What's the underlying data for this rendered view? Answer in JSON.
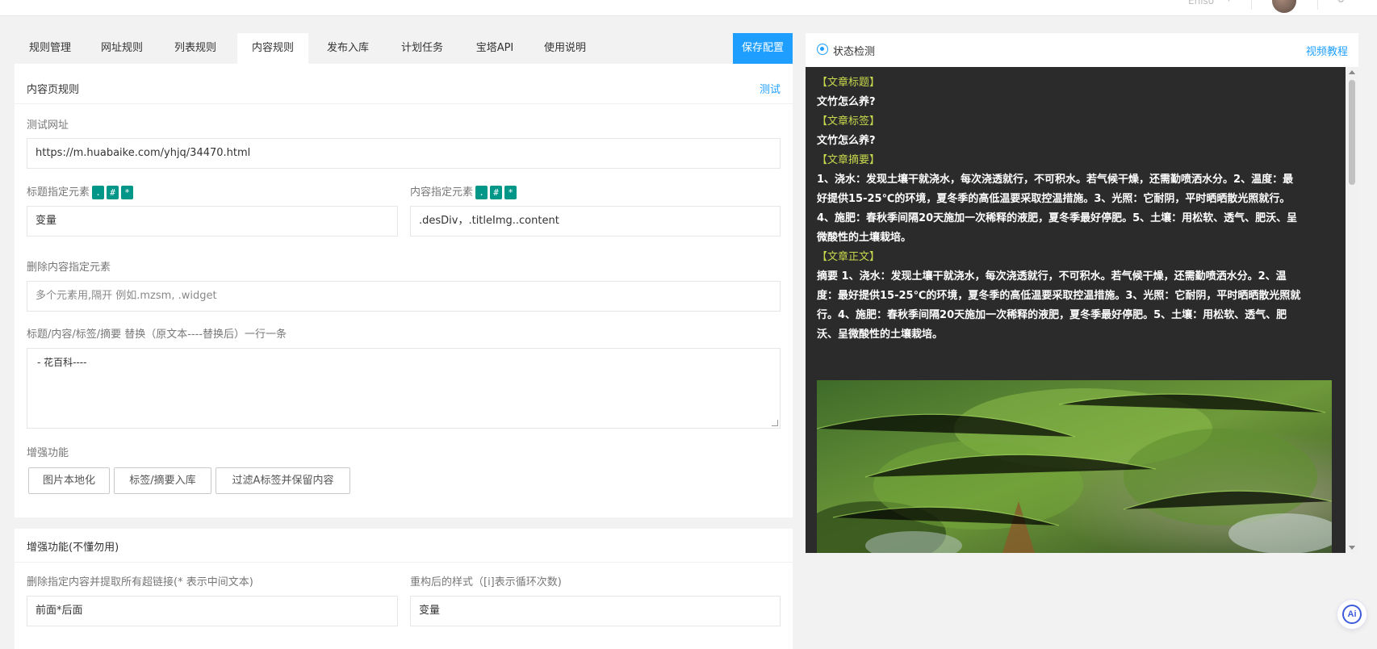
{
  "topbar": {
    "user_text": "Eniso",
    "more": "⚙"
  },
  "tabs": [
    "规则管理",
    "网址规则",
    "列表规则",
    "内容规则",
    "发布入库",
    "计划任务",
    "宝塔API",
    "使用说明"
  ],
  "active_tab": 3,
  "save_button": "保存配置",
  "content_rules": {
    "title": "内容页规则",
    "test_link": "测试",
    "test_url_label": "测试网址",
    "test_url_value": "https://m.huabaike.com/yhjq/34470.html",
    "title_elem_label": "标题指定元素",
    "title_elem_value": "变量",
    "content_elem_label": "内容指定元素",
    "content_elem_value": ".desDiv，.titleImg..content",
    "badges": [
      ".",
      "#",
      "*"
    ],
    "remove_elem_label": "删除内容指定元素",
    "remove_elem_placeholder": "多个元素用,隔开 例如.mzsm, .widget",
    "replace_label": "标题/内容/标签/摘要 替换（原文本----替换后）一行一条",
    "replace_value": " - 花百科----",
    "enhance_label": "增强功能",
    "enhance_buttons": [
      "图片本地化",
      "标签/摘要入库",
      "过滤A标签并保留内容"
    ]
  },
  "advanced": {
    "title": "增强功能(不懂勿用)",
    "delete_label": "删除指定内容并提取所有超链接(* 表示中间文本)",
    "delete_value": "前面*后面",
    "restyle_label": "重构后的样式（[i]表示循环次数)",
    "restyle_value": "变量",
    "cut_text": "..."
  },
  "status": {
    "title": "状态检测",
    "video_link": "视频教程",
    "lines": [
      {
        "tag": "【文章标题】"
      },
      {
        "text": "文竹怎么养?"
      },
      {
        "tag": "【文章标签】"
      },
      {
        "text": "文竹怎么养?"
      },
      {
        "tag": "【文章摘要】"
      },
      {
        "text": "1、浇水：发现土壤干就浇水，每次浇透就行，不可积水。若气候干燥，还需勤喷洒水分。2、温度：最"
      },
      {
        "text": "好提供15-25℃的环境，夏冬季的高低温要采取控温措施。3、光照：它耐阴，平时晒晒散光照就行。"
      },
      {
        "text": "4、施肥：春秋季间隔20天施加一次稀释的液肥，夏冬季最好停肥。5、土壤：用松软、透气、肥沃、呈"
      },
      {
        "text": "微酸性的土壤栽培。"
      },
      {
        "tag": "【文章正文】"
      },
      {
        "text": "摘要 1、浇水：发现土壤干就浇水，每次浇透就行，不可积水。若气候干燥，还需勤喷洒水分。2、温"
      },
      {
        "text": "度：最好提供15-25℃的环境，夏冬季的高低温要采取控温措施。3、光照：它耐阴，平时晒晒散光照就"
      },
      {
        "text": "行。4、施肥：春秋季间隔20天施加一次稀释的液肥，夏冬季最好停肥。5、土壤：用松软、透气、肥"
      },
      {
        "text": "沃、呈微酸性的土壤栽培。"
      }
    ]
  },
  "ai_button": "Ai",
  "colors": {
    "accent": "#1e9fff",
    "badge": "#009688",
    "console_bg": "#2b2b2b",
    "tag": "#c8d94d"
  }
}
